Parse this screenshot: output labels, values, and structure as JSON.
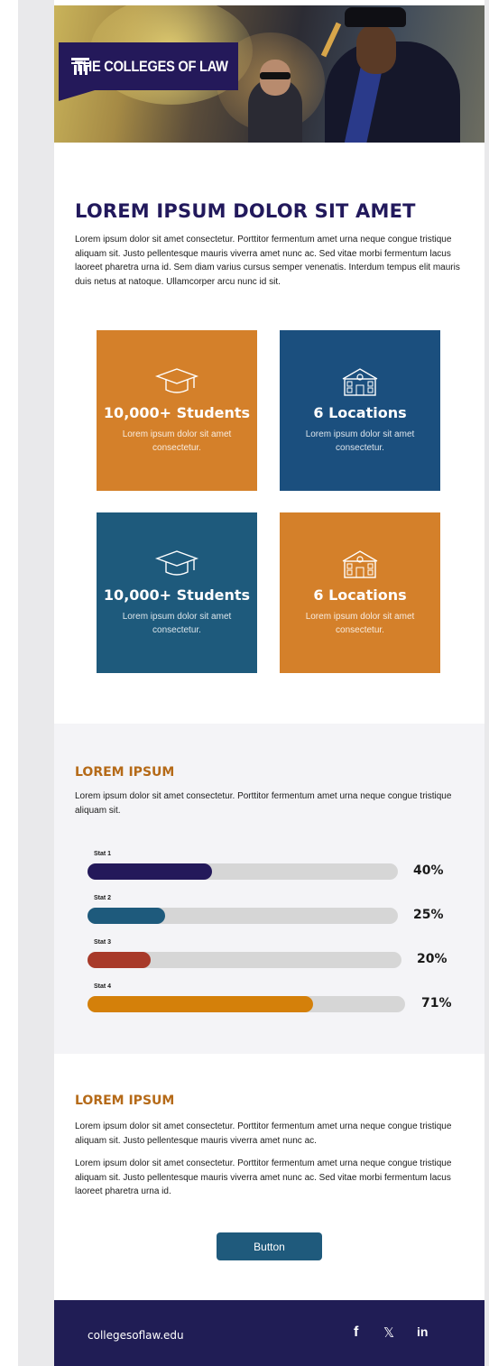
{
  "brand": {
    "logo_text": "THE COLLEGES OF LAW"
  },
  "intro": {
    "heading": "LOREM IPSUM DOLOR SIT AMET",
    "body": "Lorem ipsum dolor sit amet consectetur. Porttitor fermentum amet urna neque congue tristique aliquam sit. Justo pellentesque mauris viverra amet nunc ac. Sed vitae morbi fermentum lacus laoreet pharetra urna id. Sem diam varius cursus semper venenatis. Interdum tempus elit mauris duis netus at natoque. Ullamcorper arcu nunc id sit."
  },
  "tiles": [
    {
      "title": "10,000+ Students",
      "desc": "Lorem ipsum dolor sit amet consectetur.",
      "icon": "graduation-cap-icon",
      "color": "#d4802a"
    },
    {
      "title": "6 Locations",
      "desc": "Lorem ipsum dolor sit amet consectetur.",
      "icon": "building-icon",
      "color": "#1b4f7e"
    },
    {
      "title": "10,000+ Students",
      "desc": "Lorem ipsum dolor sit amet consectetur.",
      "icon": "graduation-cap-icon",
      "color": "#1e5a7c"
    },
    {
      "title": "6 Locations",
      "desc": "Lorem ipsum dolor sit amet consectetur.",
      "icon": "building-icon",
      "color": "#d4802a"
    }
  ],
  "stats_section": {
    "heading": "LOREM IPSUM",
    "body": "Lorem ipsum dolor sit amet consectetur. Porttitor fermentum amet urna neque congue tristique aliquam sit.",
    "stats": [
      {
        "label": "Stat 1",
        "percent_text": "40%",
        "value": 0.4,
        "color": "#24195a"
      },
      {
        "label": "Stat 2",
        "percent_text": "25%",
        "value": 0.25,
        "color": "#1e5a7c"
      },
      {
        "label": "Stat 3",
        "percent_text": "20%",
        "value": 0.2,
        "color": "#a83a2a"
      },
      {
        "label": "Stat 4",
        "percent_text": "71%",
        "value": 0.71,
        "color": "#d4800a"
      }
    ]
  },
  "text_section": {
    "heading": "LOREM IPSUM",
    "para1": "Lorem ipsum dolor sit amet consectetur. Porttitor fermentum amet urna neque congue tristique aliquam sit. Justo pellentesque mauris viverra amet nunc ac.",
    "para2": "Lorem ipsum dolor sit amet consectetur. Porttitor fermentum amet urna neque congue tristique aliquam sit. Justo pellentesque mauris viverra amet nunc ac. Sed vitae morbi fermentum lacus laoreet pharetra urna id.",
    "button_label": "Button"
  },
  "footer": {
    "url": "collegesoflaw.edu",
    "social": [
      {
        "name": "facebook",
        "glyph": "f",
        "icon": "facebook-icon"
      },
      {
        "name": "x",
        "glyph": "𝕏",
        "icon": "x-icon"
      },
      {
        "name": "linkedin",
        "glyph": "in",
        "icon": "linkedin-icon"
      }
    ]
  }
}
